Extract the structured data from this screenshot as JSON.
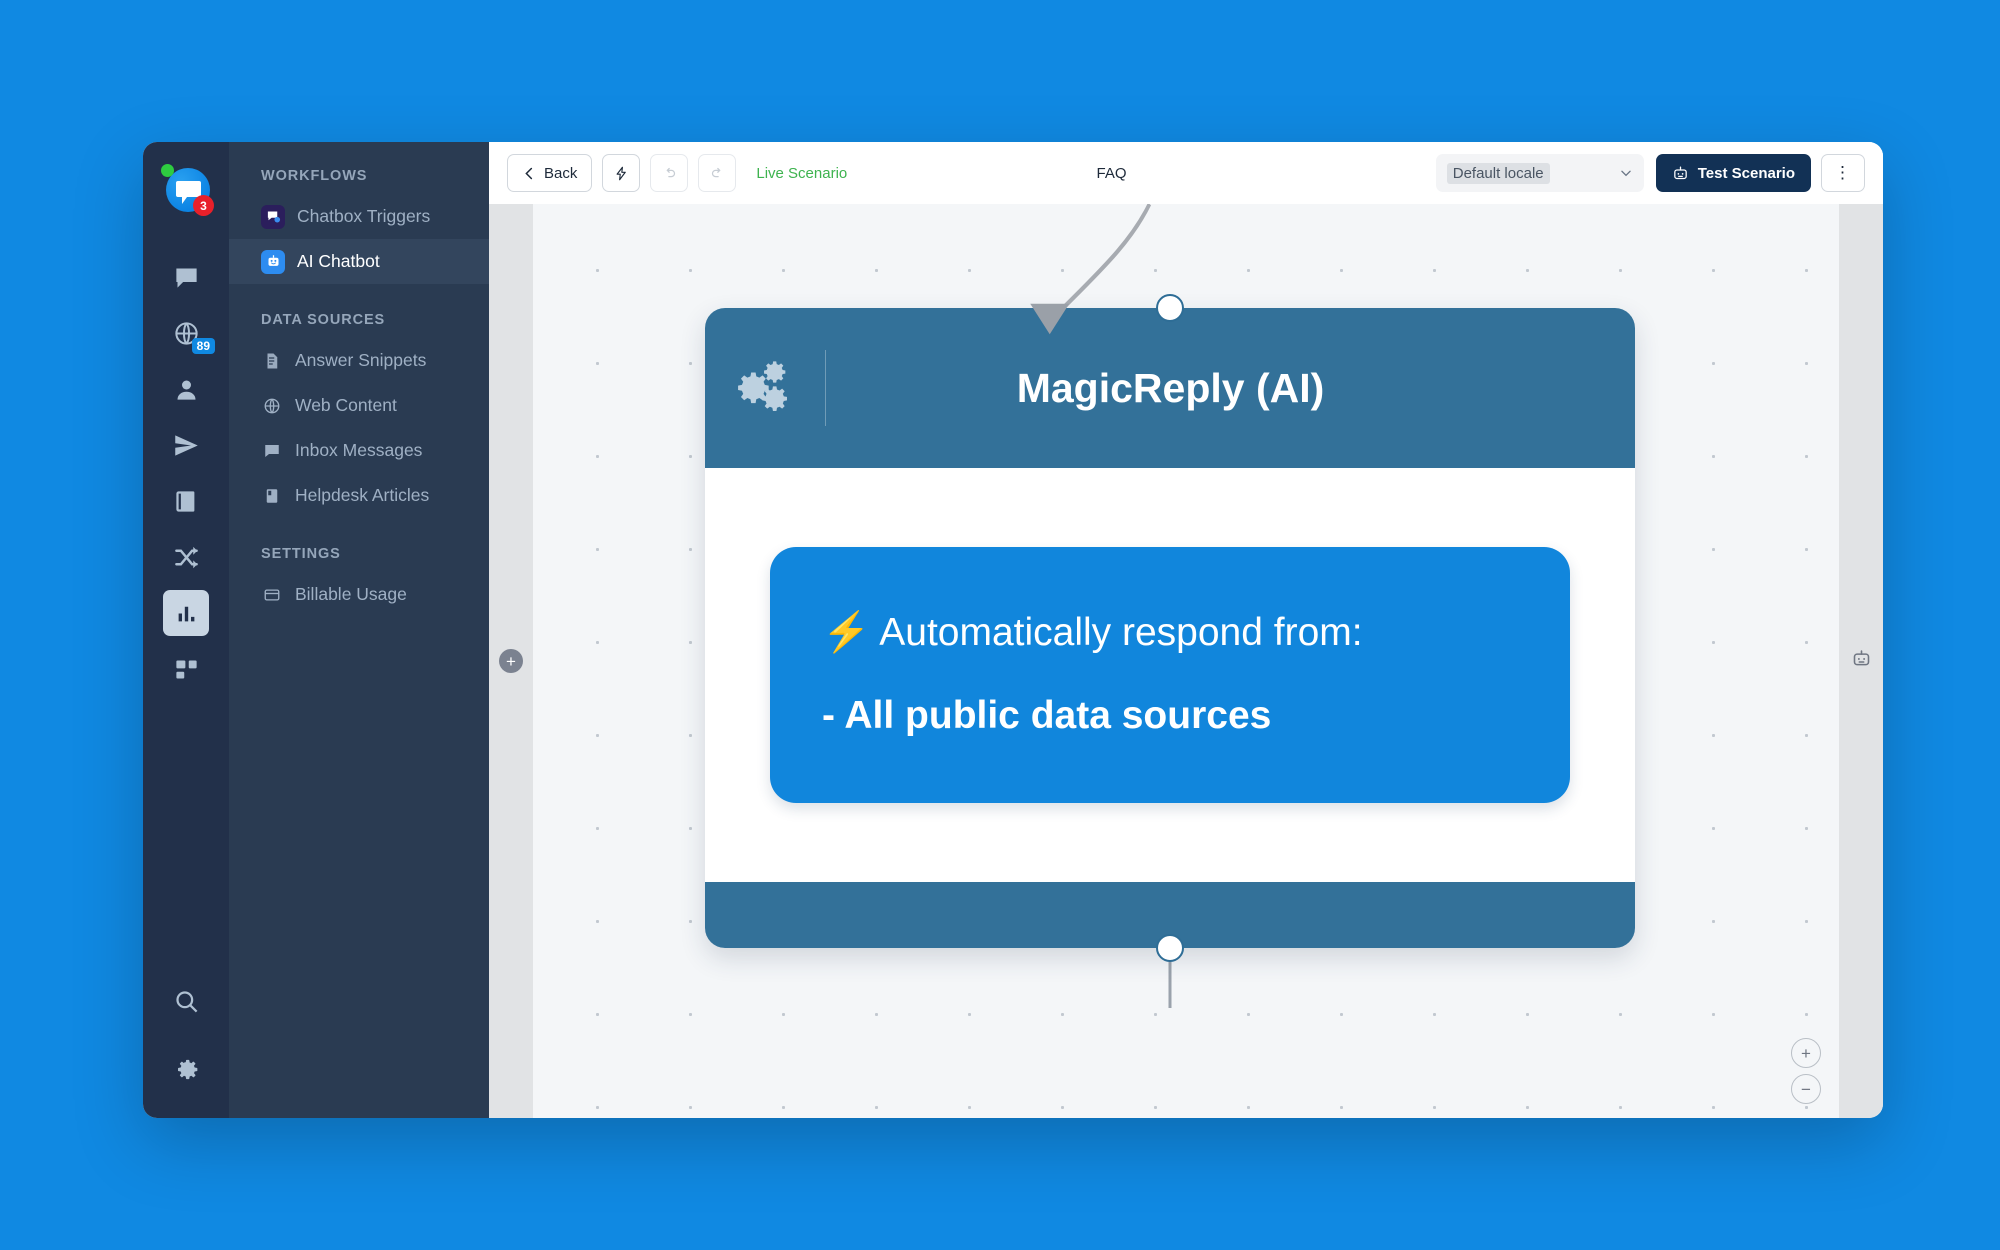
{
  "theme": {
    "page_background": "#1089E2",
    "rail_background": "#22304A",
    "nav_background": "#2A3B52",
    "node_header": "#337199",
    "bubble_blue": "#1186DC",
    "live_green": "#3EB34F",
    "test_button": "#123155",
    "badge_red": "#E8202A",
    "status_green": "#2ECC40"
  },
  "rail": {
    "logo": {
      "name": "app-logo",
      "badge_count": "3"
    },
    "icons": [
      {
        "name": "chat-icon",
        "active": false
      },
      {
        "name": "globe-icon",
        "active": false,
        "badge": "89"
      },
      {
        "name": "contacts-icon",
        "active": false
      },
      {
        "name": "send-icon",
        "active": false
      },
      {
        "name": "book-icon",
        "active": false
      },
      {
        "name": "shuffle-icon",
        "active": false
      },
      {
        "name": "bar-chart-icon",
        "active": true
      },
      {
        "name": "apps-grid-icon",
        "active": false
      }
    ],
    "bottom_icons": [
      {
        "name": "search-icon"
      },
      {
        "name": "gear-icon"
      }
    ]
  },
  "nav": {
    "sections": [
      {
        "title": "WORKFLOWS",
        "items": [
          {
            "label": "Chatbox Triggers",
            "icon": "chatbox-triggers-icon",
            "selected": false
          },
          {
            "label": "AI Chatbot",
            "icon": "ai-chatbot-icon",
            "selected": true
          }
        ]
      },
      {
        "title": "DATA SOURCES",
        "items": [
          {
            "label": "Answer Snippets",
            "icon": "document-icon",
            "selected": false
          },
          {
            "label": "Web Content",
            "icon": "globe-icon",
            "selected": false
          },
          {
            "label": "Inbox Messages",
            "icon": "message-icon",
            "selected": false
          },
          {
            "label": "Helpdesk Articles",
            "icon": "article-icon",
            "selected": false
          }
        ]
      },
      {
        "title": "SETTINGS",
        "items": [
          {
            "label": "Billable Usage",
            "icon": "card-icon",
            "selected": false
          }
        ]
      }
    ]
  },
  "toolbar": {
    "back_label": "Back",
    "lightning_icon": "lightning-icon",
    "undo_icon": "undo-icon",
    "redo_icon": "redo-icon",
    "status_label": "Live Scenario",
    "faq_label": "FAQ",
    "locale_value": "Default locale",
    "locale_caret": "chevron-down-icon",
    "test_label": "Test Scenario",
    "test_icon": "robot-icon",
    "kebab_label": "⋮"
  },
  "canvas": {
    "left_panel_icon": "add-node-icon",
    "right_panel_icon": "robot-icon",
    "zoom_in_label": "+",
    "zoom_out_label": "−"
  },
  "node": {
    "title": "MagicReply (AI)",
    "header_icon": "gears-icon",
    "message": {
      "line1": "⚡ Automatically respond from:",
      "line2": "- All public data sources"
    },
    "ports": [
      {
        "name": "node-input-port"
      },
      {
        "name": "node-output-port"
      }
    ]
  }
}
